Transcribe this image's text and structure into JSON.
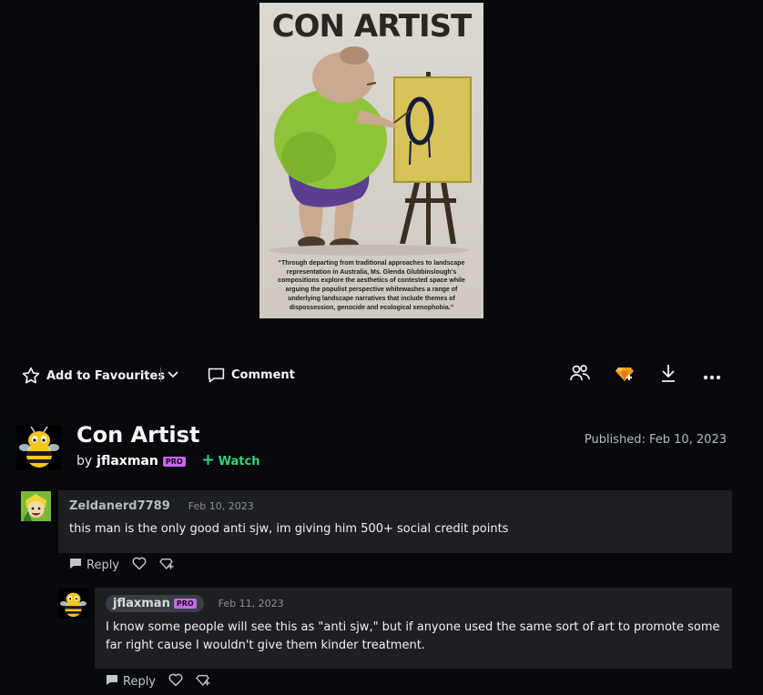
{
  "artwork": {
    "title_text": "CON ARTIST",
    "quote": "“Through departing from traditional approaches to landscape representation in Australia, Ms. Glenda Glubbinslough's compositions explore the aesthetics of contested space while arguing the populist perspective whitewashes a range of underlying landscape narratives that include themes of dispossession, genocide and ecological xenophobia.”"
  },
  "actions": {
    "favourite_label": "Add to Favourites",
    "comment_label": "Comment",
    "icons": [
      "star-icon",
      "chevron-down-icon",
      "comment-icon",
      "users-icon",
      "gem-icon",
      "download-icon",
      "more-icon"
    ]
  },
  "deviation": {
    "title": "Con Artist",
    "by_prefix": "by",
    "author": "jflaxman",
    "badge": "PRO",
    "watch_label": "Watch",
    "published": "Published: Feb 10, 2023"
  },
  "comments": [
    {
      "author": "Zeldanerd7789",
      "date": "Feb 10, 2023",
      "text": "this man is the only good anti sjw, im giving him 500+ social credit points",
      "reply_label": "Reply"
    },
    {
      "author": "jflaxman",
      "badge": "PRO",
      "date": "Feb 11, 2023",
      "text": "I know some people will see this as \"anti sjw,\" but if anyone used the same sort of art to promote some far right cause I wouldn't give them kinder treatment.",
      "reply_label": "Reply"
    }
  ],
  "colors": {
    "background": "#07090d",
    "card": "#1d1f23",
    "watch_green": "#2fd47a",
    "pro_purple": "#c36be8"
  }
}
